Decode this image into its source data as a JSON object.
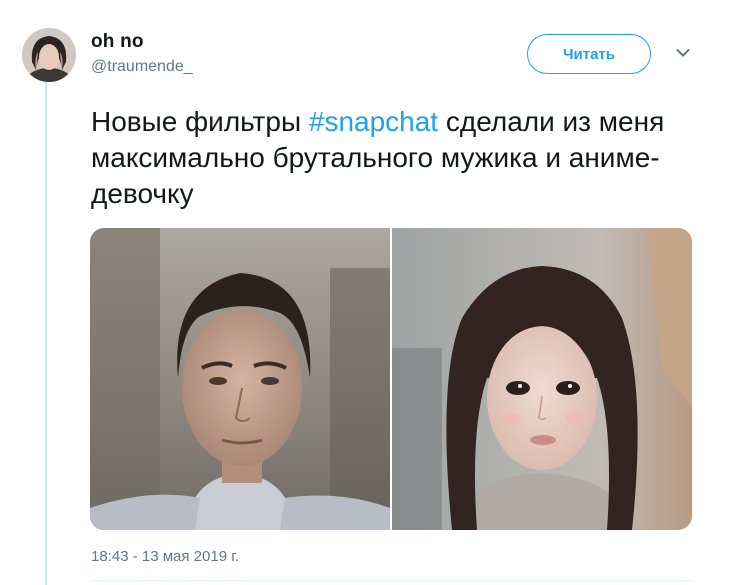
{
  "author": {
    "name": "oh no",
    "handle": "@traumende_"
  },
  "follow_label": "Читать",
  "tweet": {
    "text_before": "Новые фильтры ",
    "hashtag": "#snapchat",
    "text_after": " сделали из меня максимально брутального мужика и аниме-девочку"
  },
  "timestamp": "18:43 - 13 мая 2019 г.",
  "colors": {
    "accent": "#1da1f2",
    "text_primary": "#14171a",
    "text_secondary": "#657786",
    "thread_line": "#cce5f6"
  },
  "icons": {
    "menu": "chevron-down-icon"
  }
}
